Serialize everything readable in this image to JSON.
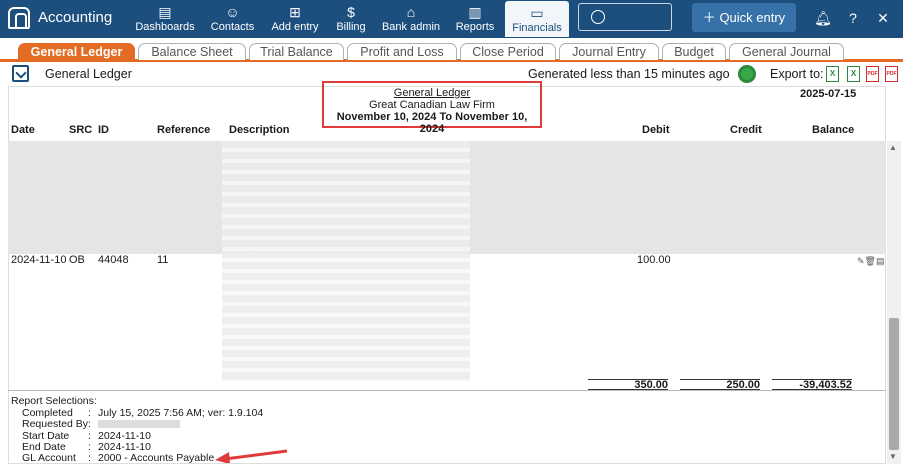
{
  "app": {
    "title": "Accounting"
  },
  "nav": [
    {
      "label": "Dashboards",
      "icon": "dashboards-icon"
    },
    {
      "label": "Contacts",
      "icon": "contacts-icon"
    },
    {
      "label": "Add entry",
      "icon": "plus-box-icon"
    },
    {
      "label": "Billing",
      "icon": "dollar-icon"
    },
    {
      "label": "Bank admin",
      "icon": "bank-icon"
    },
    {
      "label": "Reports",
      "icon": "bar-chart-icon"
    },
    {
      "label": "Financials",
      "icon": "money-icon"
    }
  ],
  "quick_entry": "Quick entry",
  "tabs": [
    "General Ledger",
    "Balance Sheet",
    "Trial Balance",
    "Profit and Loss",
    "Close Period",
    "Journal Entry",
    "Budget",
    "General Journal"
  ],
  "subheader": {
    "title": "General Ledger",
    "generated": "Generated less than 15 minutes ago",
    "export_label": "Export to:",
    "export_formats": [
      "X",
      "X",
      "PDF",
      "PDF"
    ]
  },
  "report": {
    "title": "General Ledger",
    "firm": "Great Canadian Law Firm",
    "range": "November 10, 2024 To November 10, 2024",
    "date": "2025-07-15",
    "columns": [
      "Date",
      "SRC",
      "ID",
      "Reference",
      "Description",
      "Debit",
      "Credit",
      "Balance"
    ],
    "row": {
      "date": "2024-11-10",
      "src": "OB",
      "id": "44048",
      "reference": "11",
      "debit": "100.00"
    },
    "totals": {
      "debit": "350.00",
      "credit": "250.00",
      "balance": "-39,403.52"
    }
  },
  "selections": {
    "title": "Report Selections:",
    "items": [
      {
        "key": "Completed",
        "value": "July 15, 2025 7:56 AM; ver: 1.9.104"
      },
      {
        "key": "Requested By",
        "value": ""
      },
      {
        "key": "Start Date",
        "value": "2024-11-10"
      },
      {
        "key": "End Date",
        "value": "2024-11-10"
      },
      {
        "key": "GL Account",
        "value": "2000 - Accounts Payable"
      }
    ]
  },
  "colors": {
    "brand": "#1d4f7e",
    "accent": "#e46b23",
    "highlight": "#e03b3b"
  }
}
